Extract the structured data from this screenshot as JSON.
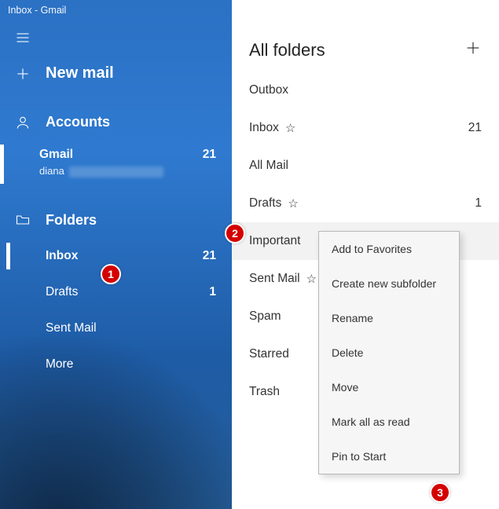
{
  "titlebar": "Inbox - Gmail",
  "sidebar": {
    "new_mail": "New mail",
    "accounts_label": "Accounts",
    "account": {
      "name": "Gmail",
      "count": "21",
      "sub": "diana"
    },
    "folders_label": "Folders",
    "items": [
      {
        "label": "Inbox",
        "count": "21",
        "bold": true
      },
      {
        "label": "Drafts",
        "count": "1"
      },
      {
        "label": "Sent Mail",
        "count": ""
      },
      {
        "label": "More",
        "count": ""
      }
    ]
  },
  "panel": {
    "header": "All folders",
    "folders": [
      {
        "label": "Outbox",
        "star": false,
        "count": ""
      },
      {
        "label": "Inbox",
        "star": true,
        "count": "21"
      },
      {
        "label": "All Mail",
        "star": false,
        "count": ""
      },
      {
        "label": "Drafts",
        "star": true,
        "count": "1"
      },
      {
        "label": "Important",
        "star": false,
        "count": "",
        "hover": true
      },
      {
        "label": "Sent Mail",
        "star": true,
        "count": ""
      },
      {
        "label": "Spam",
        "star": false,
        "count": ""
      },
      {
        "label": "Starred",
        "star": false,
        "count": ""
      },
      {
        "label": "Trash",
        "star": false,
        "count": ""
      }
    ]
  },
  "ctx": [
    "Add to Favorites",
    "Create new subfolder",
    "Rename",
    "Delete",
    "Move",
    "Mark all as read",
    "Pin to Start"
  ],
  "badges": {
    "b1": "1",
    "b2": "2",
    "b3": "3"
  }
}
